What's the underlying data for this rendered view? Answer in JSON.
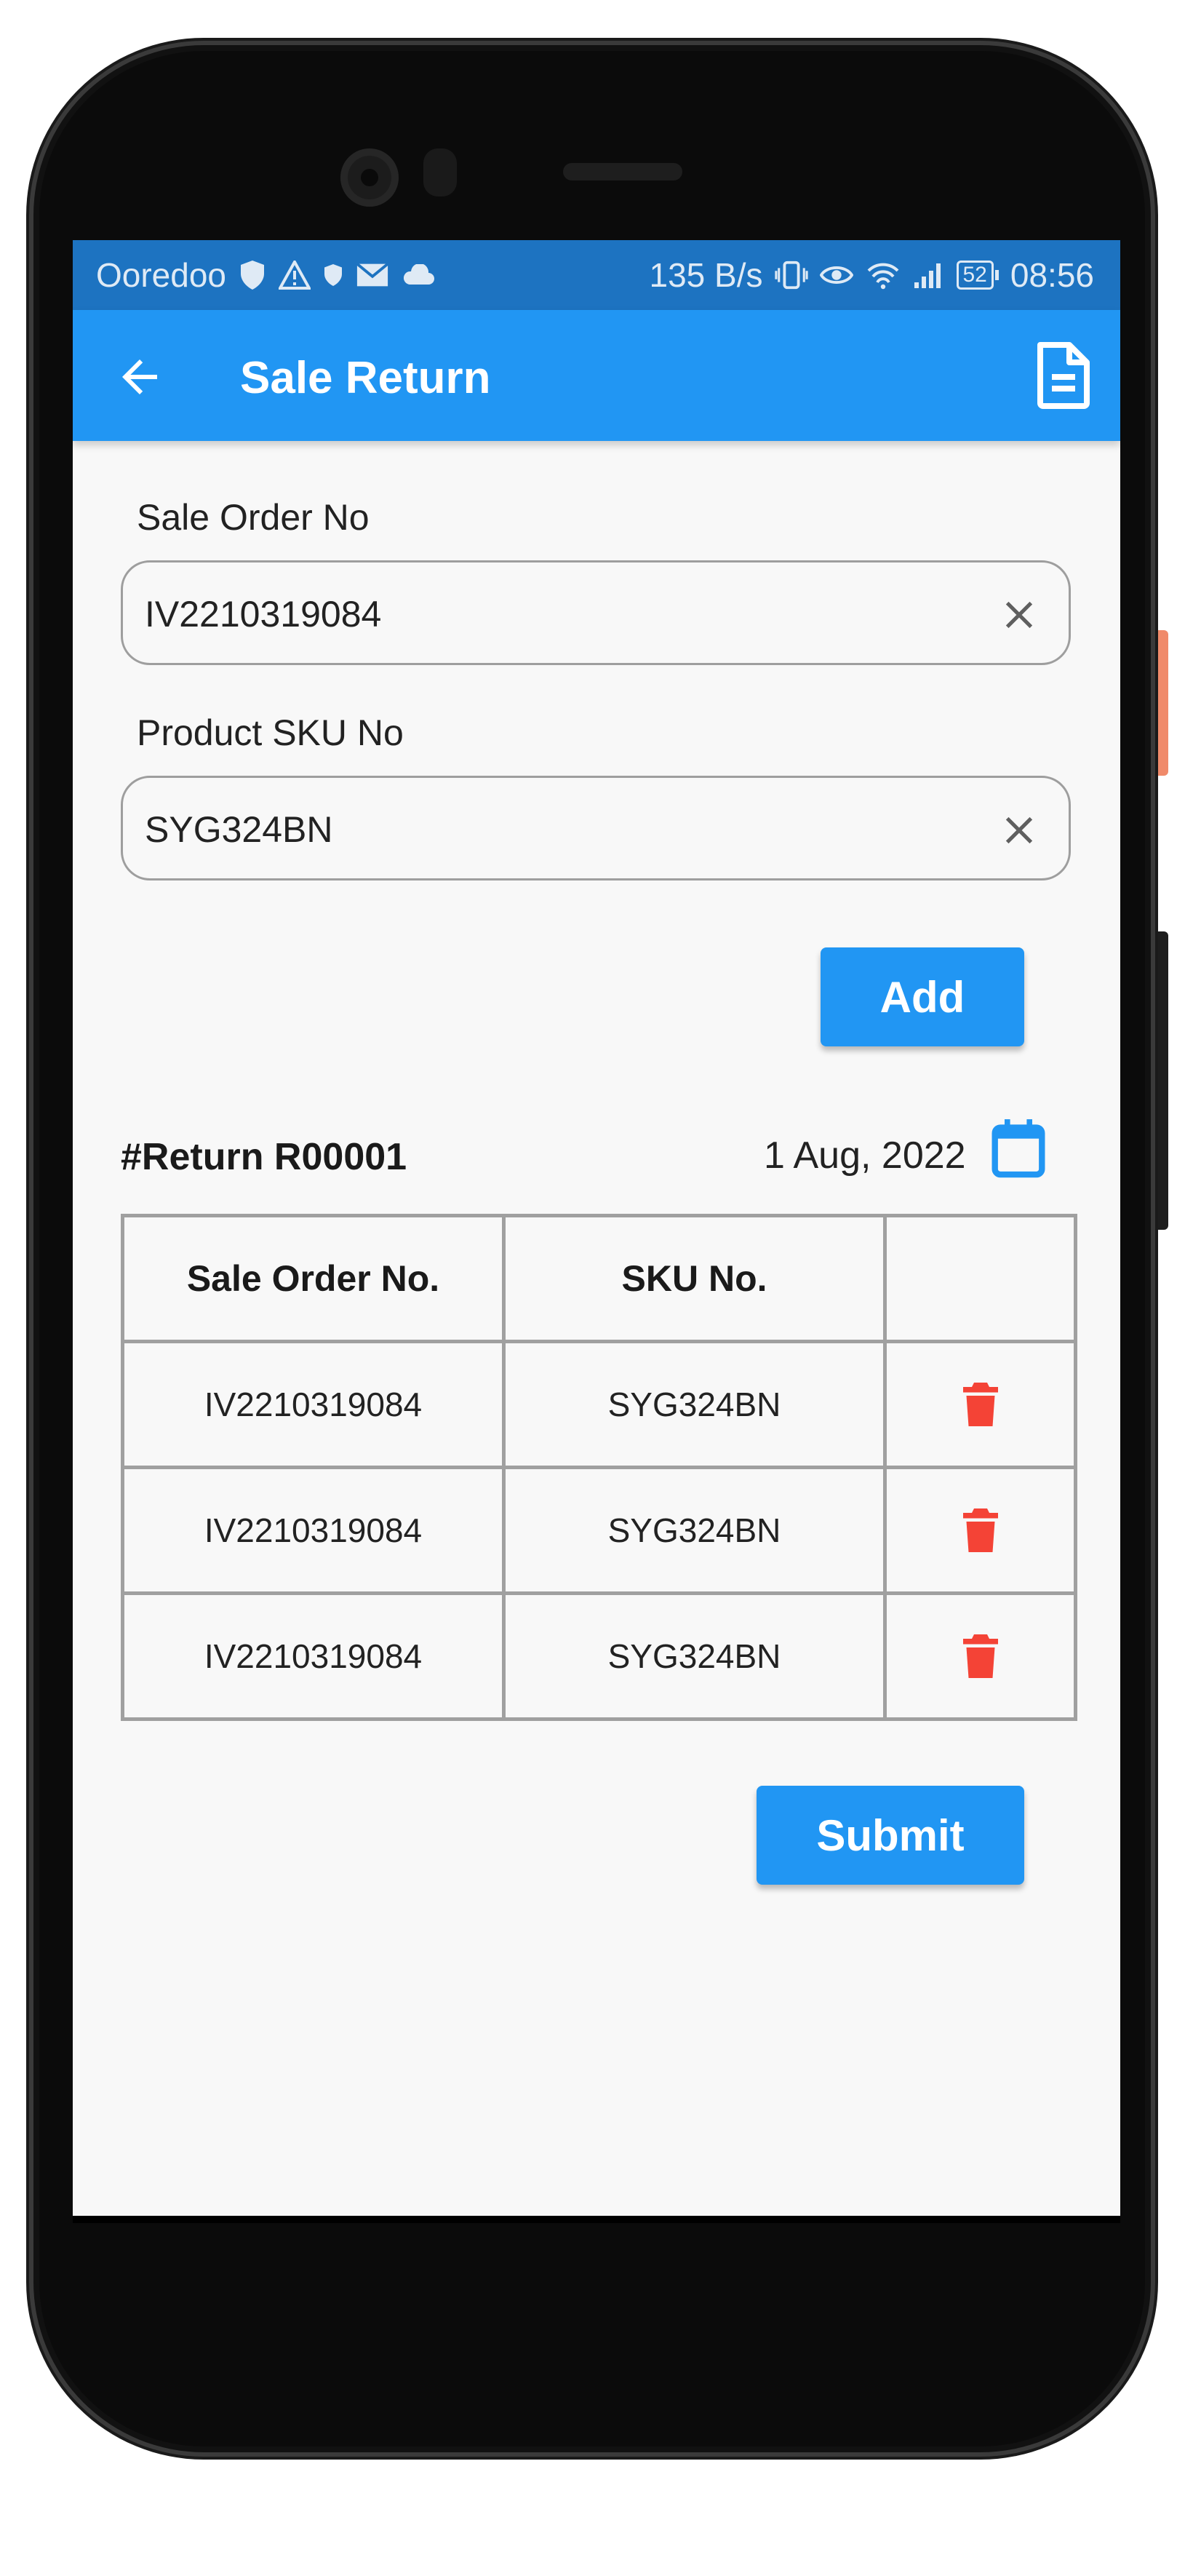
{
  "status_bar": {
    "carrier": "Ooredoo",
    "net_speed": "135 B/s",
    "battery": "52",
    "time": "08:56"
  },
  "app_bar": {
    "title": "Sale Return"
  },
  "form": {
    "sale_order_label": "Sale Order No",
    "sale_order_value": "IV2210319084",
    "sku_label": "Product SKU No",
    "sku_value": "SYG324BN",
    "add_label": "Add"
  },
  "return": {
    "number": "#Return R00001",
    "date": "1 Aug, 2022"
  },
  "table": {
    "headers": [
      "Sale Order No.",
      "SKU No.",
      ""
    ],
    "rows": [
      {
        "sale_order": "IV2210319084",
        "sku": "SYG324BN"
      },
      {
        "sale_order": "IV2210319084",
        "sku": "SYG324BN"
      },
      {
        "sale_order": "IV2210319084",
        "sku": "SYG324BN"
      }
    ]
  },
  "submit_label": "Submit",
  "colors": {
    "primary": "#2196f3",
    "status_bar": "#1d73c1",
    "delete": "#f44336",
    "calendar": "#2196f3"
  }
}
